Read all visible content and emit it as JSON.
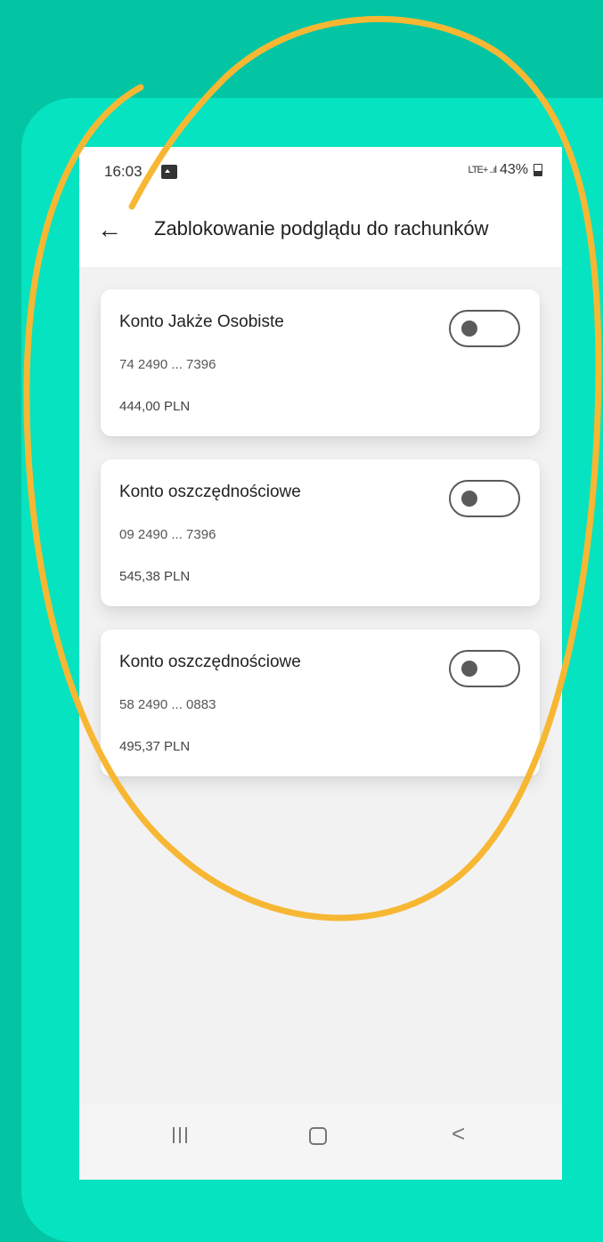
{
  "status_bar": {
    "time": "16:03",
    "signal_text": "LTE+ ..ıl",
    "battery": "43%"
  },
  "header": {
    "back_symbol": "←",
    "title": "Zablokowanie podglądu do rachunków"
  },
  "accounts": [
    {
      "name": "Konto Jakże Osobiste",
      "number": "74 2490 ... 7396",
      "balance": "444,00 PLN",
      "blocked": false
    },
    {
      "name": "Konto oszczędnościowe",
      "number": "09 2490 ... 7396",
      "balance": "545,38 PLN",
      "blocked": false
    },
    {
      "name": "Konto oszczędnościowe",
      "number": "58 2490 ... 0883",
      "balance": "495,37 PLN",
      "blocked": false
    }
  ],
  "nav": {
    "back_symbol": "<"
  },
  "colors": {
    "background": "#03c5a4",
    "card": "#06e3c0",
    "annotation": "#f7b733"
  },
  "icons": [
    "gallery-icon",
    "mute-icon",
    "signal-icon",
    "battery-icon",
    "back-arrow-icon",
    "recents-icon",
    "home-icon",
    "nav-back-icon"
  ]
}
